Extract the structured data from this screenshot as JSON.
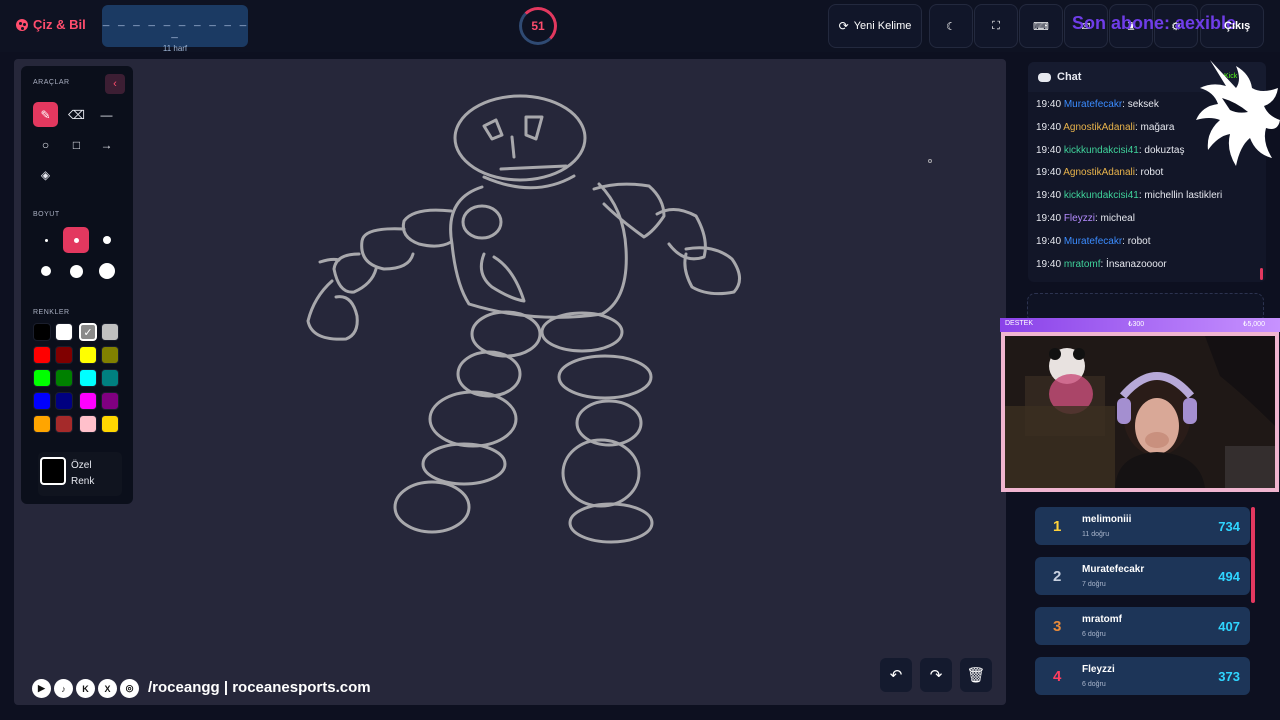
{
  "app": {
    "name": "Çiz & Bil"
  },
  "word": {
    "mask": "_ _ _ _ _ _ _ _ _ _ _",
    "hint": "11 harf"
  },
  "timer": {
    "value": "51"
  },
  "toolbar": {
    "new_word_label": "Yeni Kelime",
    "exit_label": "Çıkış",
    "promo_text": "Son abone: aexible"
  },
  "tools": {
    "title": "ARAÇLAR",
    "size_title": "BOYUT",
    "colors_title": "RENKLER",
    "custom_color": "Özel Renk",
    "items": [
      "brush-tool",
      "eraser-tool",
      "line-tool",
      "circle-tool",
      "rectangle-tool",
      "arrow-tool",
      "fill-tool"
    ],
    "selected_color": "#d9d9d9",
    "colors": [
      "#000000",
      "#ffffff",
      "#808080",
      "#c0c0c0",
      "#ff0000",
      "#800000",
      "#ffff00",
      "#808000",
      "#00ff00",
      "#008000",
      "#00ffff",
      "#008080",
      "#0000ff",
      "#000080",
      "#ff00ff",
      "#800080",
      "#ffa500",
      "#a52a2a",
      "#ffc0cb",
      "#ffd700"
    ]
  },
  "socials": {
    "handles": "/roceangg | roceanesports.com"
  },
  "chat": {
    "title": "Chat",
    "source": "Kick",
    "messages": [
      {
        "time": "19:40",
        "user": "Muratefecakr",
        "text": ": seksek",
        "color": "#3b8cff"
      },
      {
        "time": "19:40",
        "user": "AgnostikAdanali",
        "text": ": mağara",
        "color": "#e8b34b"
      },
      {
        "time": "19:40",
        "user": "kickkundakcisi41",
        "text": ": dokuztaş",
        "color": "#3fd29a"
      },
      {
        "time": "19:40",
        "user": "AgnostikAdanali",
        "text": ": robot",
        "color": "#e8b34b"
      },
      {
        "time": "19:40",
        "user": "kickkundakcisi41",
        "text": ": michellin lastikleri",
        "color": "#3fd29a"
      },
      {
        "time": "19:40",
        "user": "Fleyzzi",
        "text": ": micheal",
        "color": "#b58cff"
      },
      {
        "time": "19:40",
        "user": "Muratefecakr",
        "text": ": robot",
        "color": "#3b8cff"
      },
      {
        "time": "19:40",
        "user": "mratomf",
        "text": ": İnsanazoooor",
        "color": "#3fd29a"
      }
    ]
  },
  "support": {
    "label": "DESTEK",
    "current": "₺300",
    "goal": "₺5,000"
  },
  "leaderboard": [
    {
      "rank": "1",
      "name": "melimoniii",
      "correct": "11 doğru",
      "score": "734",
      "rank_color": "#ffd23a"
    },
    {
      "rank": "2",
      "name": "Muratefecakr",
      "correct": "7 doğru",
      "score": "494",
      "rank_color": "#c8d1e0"
    },
    {
      "rank": "3",
      "name": "mratomf",
      "correct": "6 doğru",
      "score": "407",
      "rank_color": "#e88b3a"
    },
    {
      "rank": "4",
      "name": "Fleyzzi",
      "correct": "6 doğru",
      "score": "373",
      "rank_color": "#ff3d5f"
    }
  ]
}
